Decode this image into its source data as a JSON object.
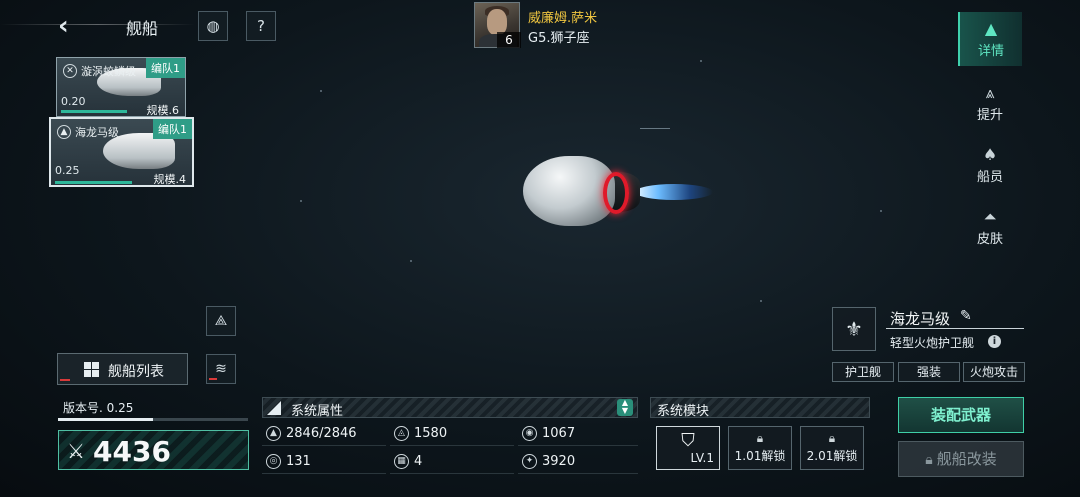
{
  "header": {
    "back_icon": "chevron-left-icon",
    "title": "舰船",
    "planet_icon": "planet-icon",
    "help_icon": "help-icon"
  },
  "commander": {
    "name": "威廉姆.萨米",
    "level": "6",
    "location": "G5.狮子座"
  },
  "fleet_cards": [
    {
      "name": "漩涡蛟鳞级",
      "team": "编队1",
      "version": "0.20",
      "scale": "规模.6",
      "progress": 0.55
    },
    {
      "name": "海龙马级",
      "team": "编队1",
      "version": "0.25",
      "scale": "规模.4",
      "progress": 0.58
    }
  ],
  "side_menu": [
    {
      "label": "详情",
      "icon": "details-icon",
      "active": true
    },
    {
      "label": "提升",
      "icon": "upgrade-icon",
      "active": false
    },
    {
      "label": "船员",
      "icon": "crew-icon",
      "active": false
    },
    {
      "label": "皮肤",
      "icon": "skin-icon",
      "active": false
    }
  ],
  "ship": {
    "name": "海龙马级",
    "class": "轻型火炮护卫舰",
    "tags": [
      "护卫舰",
      "强装",
      "火炮攻击"
    ]
  },
  "left_panel": {
    "ship_list_label": "舰船列表",
    "version_label": "版本号. 0.25",
    "version_progress": 0.5,
    "power": "4436"
  },
  "attributes": {
    "title": "系统属性",
    "items": [
      {
        "icon": "hull-icon",
        "value": "2846/2846"
      },
      {
        "icon": "armor-icon",
        "value": "1580"
      },
      {
        "icon": "shield-icon",
        "value": "1067"
      },
      {
        "icon": "speed-icon",
        "value": "131"
      },
      {
        "icon": "grid-icon",
        "value": "4"
      },
      {
        "icon": "target-icon",
        "value": "3920"
      }
    ]
  },
  "modules": {
    "title": "系统模块",
    "slots": [
      {
        "label": "LV.1",
        "locked": false
      },
      {
        "label": "1.01解锁",
        "locked": true
      },
      {
        "label": "2.01解锁",
        "locked": true
      }
    ]
  },
  "actions": {
    "equip_label": "装配武器",
    "modify_label": "舰船改装"
  }
}
